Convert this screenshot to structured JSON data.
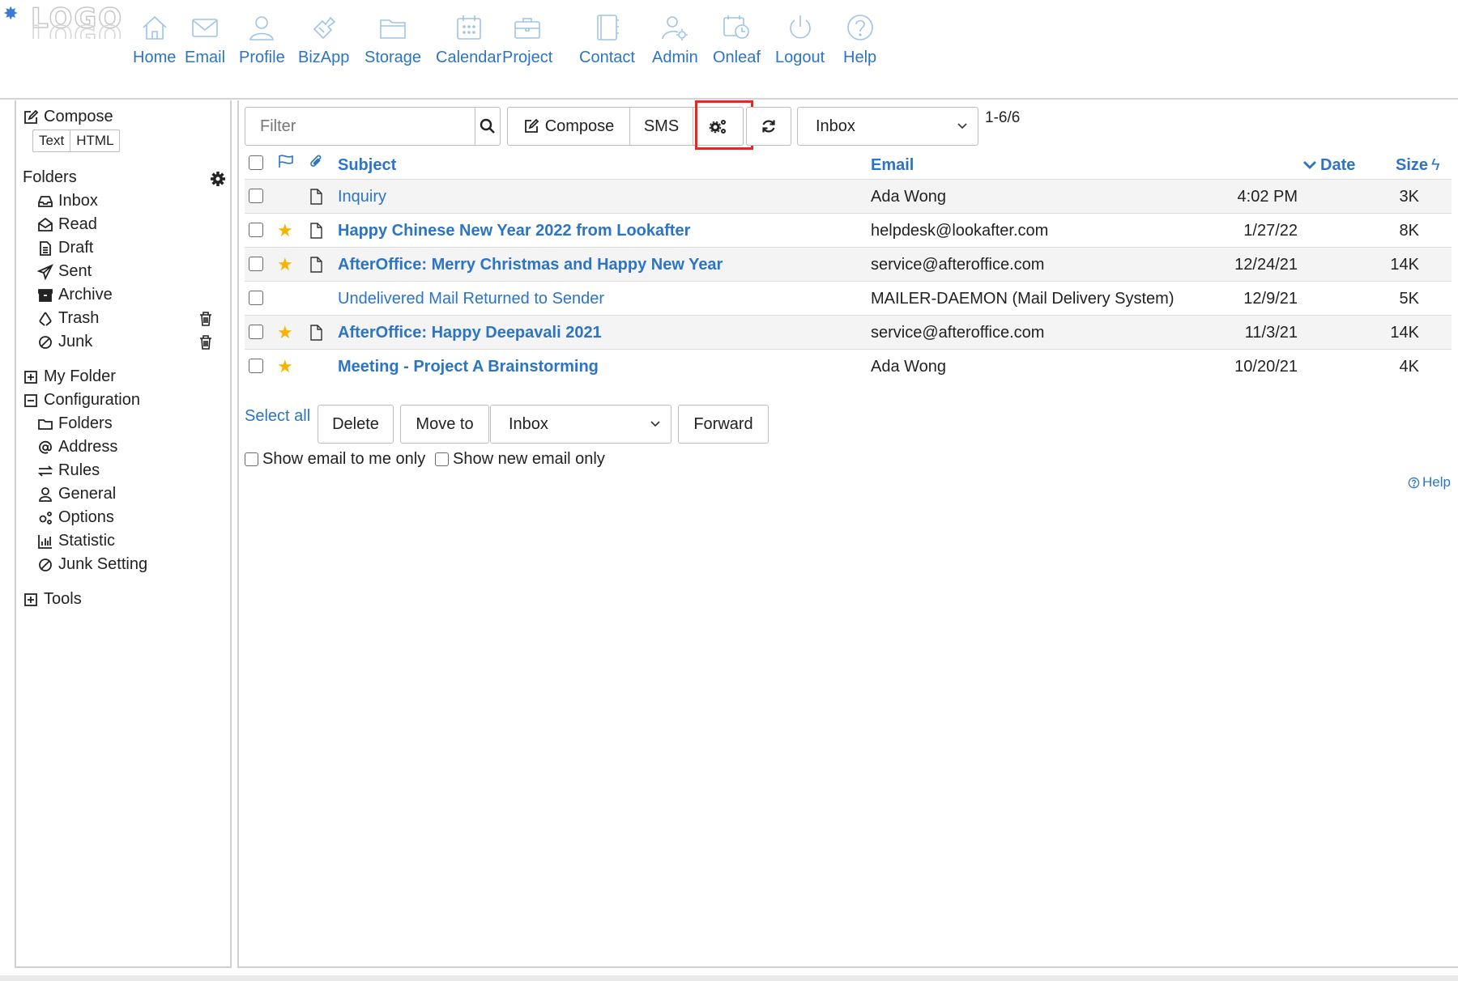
{
  "logo": {
    "text": "LOGO"
  },
  "nav": [
    {
      "label": "Home",
      "icon": "home-icon"
    },
    {
      "label": "Email",
      "icon": "email-icon"
    },
    {
      "label": "Profile",
      "icon": "profile-icon"
    },
    {
      "label": "BizApp",
      "icon": "bizapp-icon"
    },
    {
      "label": "Storage",
      "icon": "storage-icon"
    },
    {
      "label": "Calendar",
      "icon": "calendar-icon"
    },
    {
      "label": "Project",
      "icon": "project-icon"
    },
    {
      "label": "Contact",
      "icon": "contact-icon"
    },
    {
      "label": "Admin",
      "icon": "admin-icon"
    },
    {
      "label": "Onleaf",
      "icon": "onleaf-icon"
    },
    {
      "label": "Logout",
      "icon": "logout-icon"
    },
    {
      "label": "Help",
      "icon": "help-icon"
    }
  ],
  "sidebar": {
    "compose": "Compose",
    "format_text": "Text",
    "format_html": "HTML",
    "folders_title": "Folders",
    "folders": [
      "Inbox",
      "Read",
      "Draft",
      "Sent",
      "Archive",
      "Trash",
      "Junk"
    ],
    "my_folder": "My Folder",
    "configuration": "Configuration",
    "config_items": [
      "Folders",
      "Address",
      "Rules",
      "General",
      "Options",
      "Statistic",
      "Junk Setting"
    ],
    "tools": "Tools"
  },
  "toolbar": {
    "filter_placeholder": "Filter",
    "compose": "Compose",
    "sms": "SMS",
    "folder_select": "Inbox",
    "pager": "1-6/6"
  },
  "table": {
    "headers": {
      "subject": "Subject",
      "email": "Email",
      "date": "Date",
      "size": "Size"
    },
    "rows": [
      {
        "starred": false,
        "doc": true,
        "subject": "Inquiry",
        "bold": false,
        "email": "Ada Wong",
        "date": "4:02 PM",
        "size": "3K"
      },
      {
        "starred": true,
        "doc": true,
        "subject": "Happy Chinese New Year 2022 from Lookafter",
        "bold": true,
        "email": "helpdesk@lookafter.com",
        "date": "1/27/22",
        "size": "8K"
      },
      {
        "starred": true,
        "doc": true,
        "subject": "AfterOffice: Merry Christmas and Happy New Year",
        "bold": true,
        "email": "service@afteroffice.com",
        "date": "12/24/21",
        "size": "14K"
      },
      {
        "starred": false,
        "doc": false,
        "subject": "Undelivered Mail Returned to Sender",
        "bold": false,
        "email": "MAILER-DAEMON (Mail Delivery System)",
        "date": "12/9/21",
        "size": "5K"
      },
      {
        "starred": true,
        "doc": true,
        "subject": "AfterOffice: Happy Deepavali 2021",
        "bold": true,
        "email": "service@afteroffice.com",
        "date": "11/3/21",
        "size": "14K"
      },
      {
        "starred": true,
        "doc": false,
        "subject": "Meeting - Project A Brainstorming",
        "bold": true,
        "email": "Ada Wong",
        "date": "10/20/21",
        "size": "4K"
      }
    ]
  },
  "actions": {
    "select_all": "Select all",
    "delete": "Delete",
    "move_to": "Move to",
    "move_select": "Inbox",
    "forward": "Forward",
    "show_to_me": "Show email to me only",
    "show_new": "Show new email only",
    "help": "Help"
  },
  "colors": {
    "link": "#2c74c4",
    "highlight": "#e8281c",
    "star": "#f5b400"
  }
}
